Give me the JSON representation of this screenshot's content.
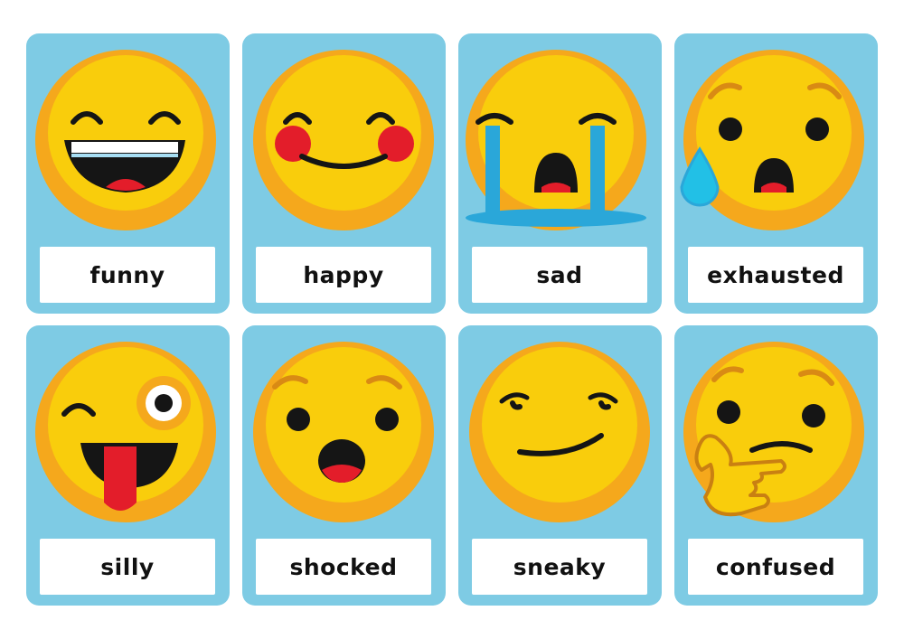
{
  "cards": [
    {
      "label": "funny",
      "face": "laughing-face-icon"
    },
    {
      "label": "happy",
      "face": "blushing-smile-face-icon"
    },
    {
      "label": "sad",
      "face": "crying-face-icon"
    },
    {
      "label": "exhausted",
      "face": "anxious-sweat-face-icon"
    },
    {
      "label": "silly",
      "face": "winking-tongue-face-icon"
    },
    {
      "label": "shocked",
      "face": "surprised-face-icon"
    },
    {
      "label": "sneaky",
      "face": "smirking-face-icon"
    },
    {
      "label": "confused",
      "face": "thinking-face-icon"
    }
  ],
  "colors": {
    "card_background": "#7ecbe4",
    "face_yellow": "#f9cd0c",
    "face_rim": "#f5a81c",
    "feature_dark": "#151515",
    "tongue_red": "#e31d2a",
    "tear_blue": "#2aa7d9"
  }
}
